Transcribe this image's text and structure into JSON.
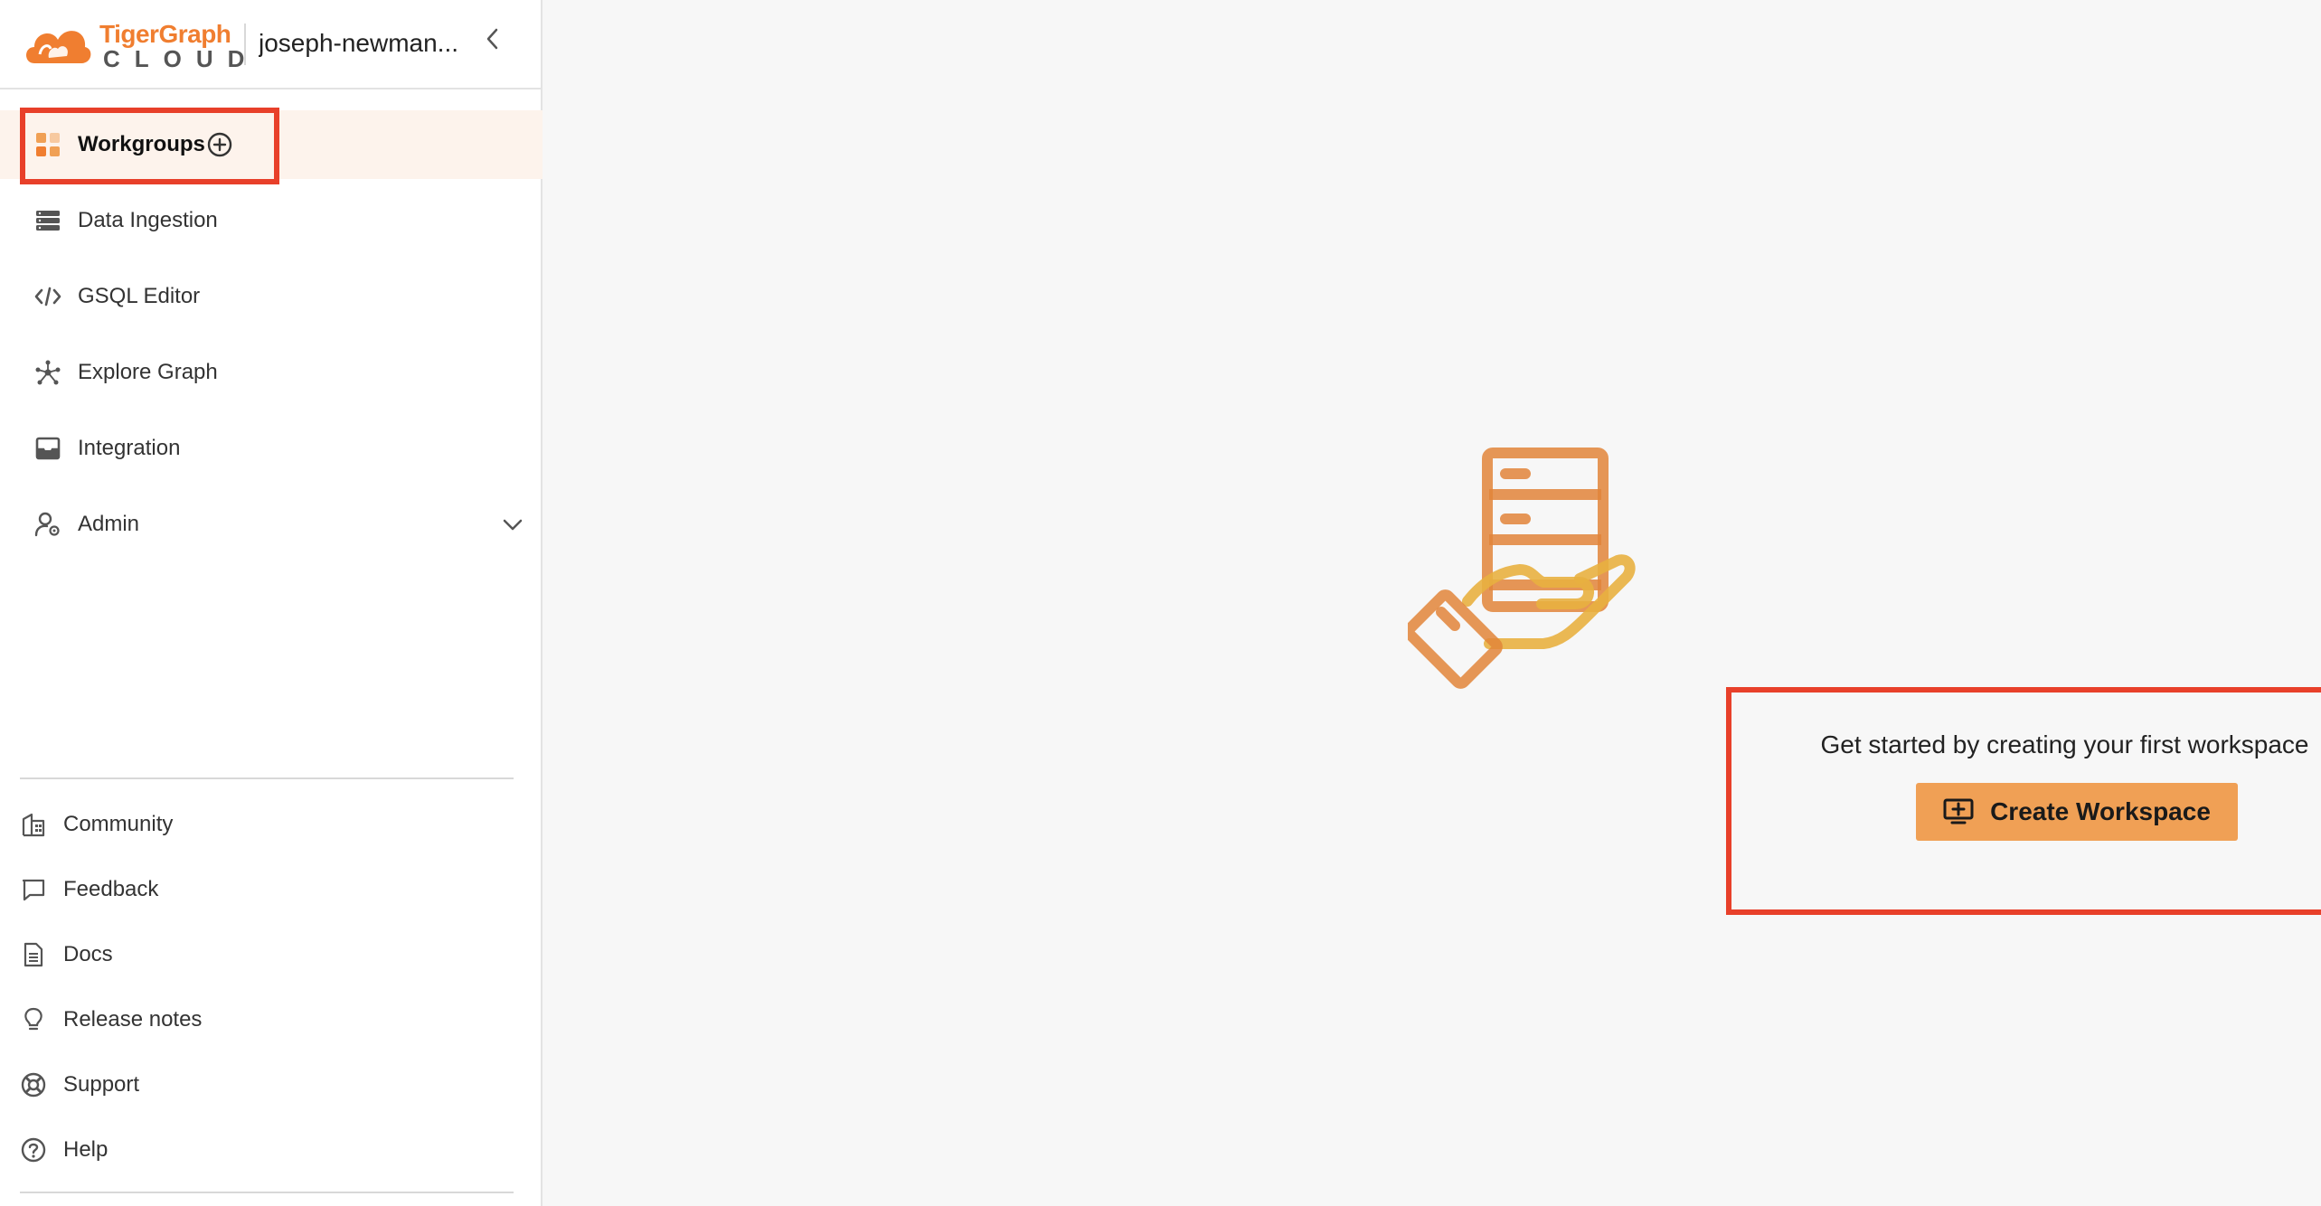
{
  "header": {
    "logo_line1": "TigerGraph",
    "logo_line2": "CLOUD",
    "account_name": "joseph-newman..."
  },
  "nav": {
    "items": [
      {
        "label": "Workgroups",
        "icon": "grid-icon",
        "active": true
      },
      {
        "label": "Data Ingestion",
        "icon": "database-icon"
      },
      {
        "label": "GSQL Editor",
        "icon": "code-icon"
      },
      {
        "label": "Explore Graph",
        "icon": "graph-icon"
      },
      {
        "label": "Integration",
        "icon": "inbox-icon"
      },
      {
        "label": "Admin",
        "icon": "user-gear-icon"
      }
    ]
  },
  "footer_links": [
    {
      "label": "Community",
      "icon": "building-icon"
    },
    {
      "label": "Feedback",
      "icon": "chat-icon"
    },
    {
      "label": "Docs",
      "icon": "document-icon"
    },
    {
      "label": "Release notes",
      "icon": "lightbulb-icon"
    },
    {
      "label": "Support",
      "icon": "lifebuoy-icon"
    },
    {
      "label": "Help",
      "icon": "question-icon"
    }
  ],
  "main": {
    "empty_message": "Get started by creating your first workspace",
    "create_button_label": "Create Workspace"
  },
  "colors": {
    "accent": "#f07e30",
    "button": "#f0a055",
    "highlight": "#e8402a",
    "active_bg": "#fdf3ec"
  }
}
